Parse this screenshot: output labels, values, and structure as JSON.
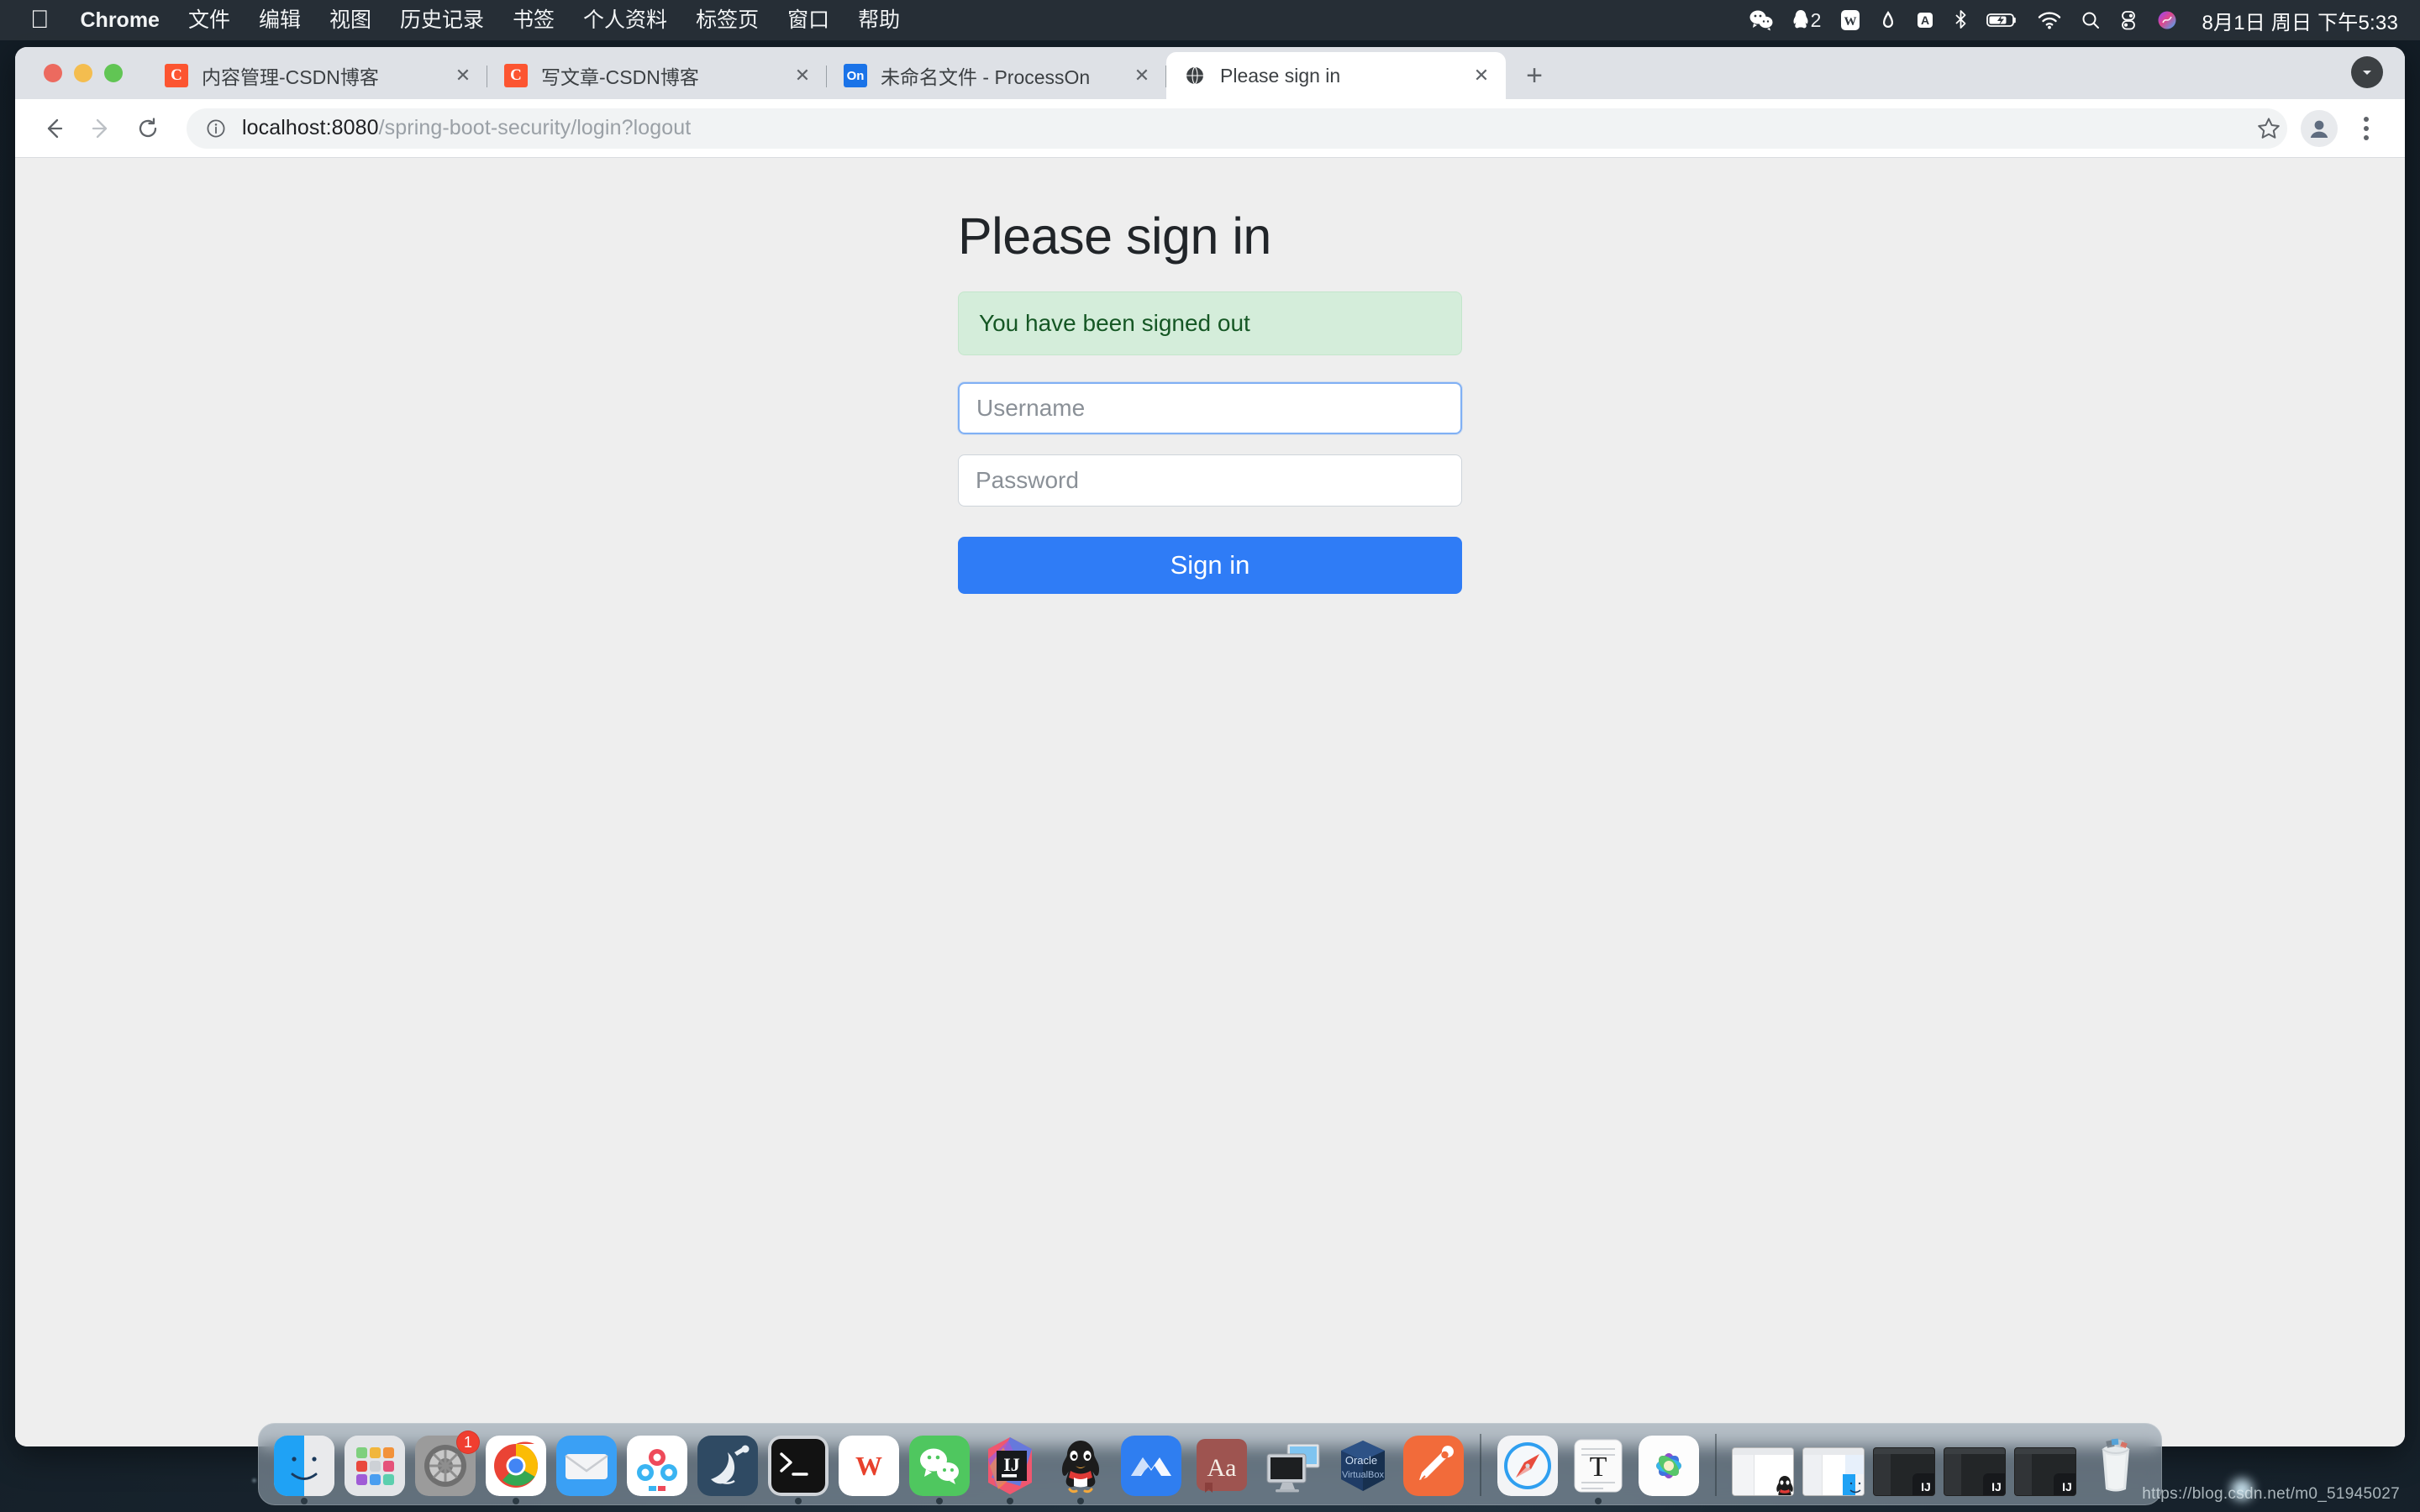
{
  "menubar": {
    "apple_icon": "apple-logo-icon",
    "items": [
      "Chrome",
      "文件",
      "编辑",
      "视图",
      "历史记录",
      "书签",
      "个人资料",
      "标签页",
      "窗口",
      "帮助"
    ],
    "tray": [
      {
        "name": "wechat-icon",
        "badge": ""
      },
      {
        "name": "qq-icon",
        "badge": "2"
      },
      {
        "name": "wps-icon",
        "badge": ""
      },
      {
        "name": "diamond-icon",
        "badge": ""
      },
      {
        "name": "input-method-icon",
        "label": "A",
        "badge": ""
      },
      {
        "name": "bluetooth-icon",
        "badge": ""
      },
      {
        "name": "battery-charging-icon",
        "badge": ""
      },
      {
        "name": "wifi-icon",
        "badge": ""
      },
      {
        "name": "spotlight-search-icon",
        "badge": ""
      },
      {
        "name": "control-center-icon",
        "badge": ""
      },
      {
        "name": "siri-icon",
        "badge": ""
      }
    ],
    "clock": "8月1日 周日 下午5:33"
  },
  "browser": {
    "tabs": [
      {
        "title": "内容管理-CSDN博客",
        "favicon": "csdn-favicon",
        "favicon_text": "C",
        "active": false,
        "close_label": "✕"
      },
      {
        "title": "写文章-CSDN博客",
        "favicon": "csdn-favicon",
        "favicon_text": "C",
        "active": false,
        "close_label": "✕"
      },
      {
        "title": "未命名文件 - ProcessOn",
        "favicon": "processon-favicon",
        "favicon_text": "On",
        "active": false,
        "close_label": "✕"
      },
      {
        "title": "Please sign in",
        "favicon": "globe-favicon",
        "favicon_text": "",
        "active": true,
        "close_label": "✕"
      }
    ],
    "new_tab_label": "+",
    "toolbar": {
      "back_label": "←",
      "forward_label": "→",
      "reload_label": "⟳",
      "url_host": "localhost:8080",
      "url_path": "/spring-boot-security/login?logout",
      "url_full": "localhost:8080/spring-boot-security/login?logout",
      "site_info_icon": "info-circle-icon",
      "bookmark_icon": "star-icon",
      "profile_icon": "avatar-icon",
      "menu_icon": "three-dot-menu-icon"
    }
  },
  "page": {
    "title": "Please sign in",
    "alert": "You have been signed out",
    "username_placeholder": "Username",
    "username_value": "",
    "password_placeholder": "Password",
    "password_value": "",
    "signin_label": "Sign in",
    "colors": {
      "background": "#eeeeee",
      "alert_bg": "#d4edda",
      "alert_border": "#c3e6cb",
      "alert_text": "#155724",
      "button": "#2f7cf6",
      "focus_border": "#80b0f4"
    }
  },
  "dock": {
    "items": [
      {
        "name": "finder-icon",
        "running": true,
        "badge": ""
      },
      {
        "name": "launchpad-icon",
        "running": false,
        "badge": ""
      },
      {
        "name": "system-preferences-icon",
        "running": false,
        "badge": "1"
      },
      {
        "name": "chrome-icon",
        "running": true,
        "badge": ""
      },
      {
        "name": "mail-icon",
        "running": false,
        "badge": ""
      },
      {
        "name": "baidu-netdisk-icon",
        "running": false,
        "badge": ""
      },
      {
        "name": "mysql-workbench-icon",
        "running": false,
        "badge": ""
      },
      {
        "name": "terminal-icon",
        "running": true,
        "badge": ""
      },
      {
        "name": "wps-office-icon",
        "running": false,
        "badge": ""
      },
      {
        "name": "wechat-icon",
        "running": true,
        "badge": ""
      },
      {
        "name": "intellij-idea-icon",
        "running": true,
        "badge": ""
      },
      {
        "name": "qq-icon",
        "running": true,
        "badge": ""
      },
      {
        "name": "motrix-icon",
        "running": false,
        "badge": ""
      },
      {
        "name": "dictionary-icon",
        "label": "Aa",
        "running": false,
        "badge": ""
      },
      {
        "name": "screen-sharing-icon",
        "running": false,
        "badge": ""
      },
      {
        "name": "virtualbox-icon",
        "running": false,
        "badge": ""
      },
      {
        "name": "postman-icon",
        "running": false,
        "badge": ""
      },
      {
        "name": "safari-icon",
        "running": false,
        "badge": ""
      },
      {
        "name": "textedit-icon",
        "running": true,
        "badge": ""
      },
      {
        "name": "photos-icon",
        "running": false,
        "badge": ""
      }
    ],
    "minimized": [
      {
        "name": "minimized-window-qq",
        "style": "light",
        "overlay": "qq-overlay-icon"
      },
      {
        "name": "minimized-window-finder",
        "style": "light",
        "overlay": "finder-overlay-icon"
      },
      {
        "name": "minimized-window-intellij-1",
        "style": "dark",
        "overlay": "intellij-overlay-icon",
        "overlay_text": "IJ"
      },
      {
        "name": "minimized-window-intellij-2",
        "style": "dark",
        "overlay": "intellij-overlay-icon",
        "overlay_text": "IJ"
      },
      {
        "name": "minimized-window-intellij-3",
        "style": "dark",
        "overlay": "intellij-overlay-icon",
        "overlay_text": "IJ"
      }
    ],
    "trash": {
      "name": "trash-icon"
    }
  },
  "watermark": "https://blog.csdn.net/m0_51945027"
}
